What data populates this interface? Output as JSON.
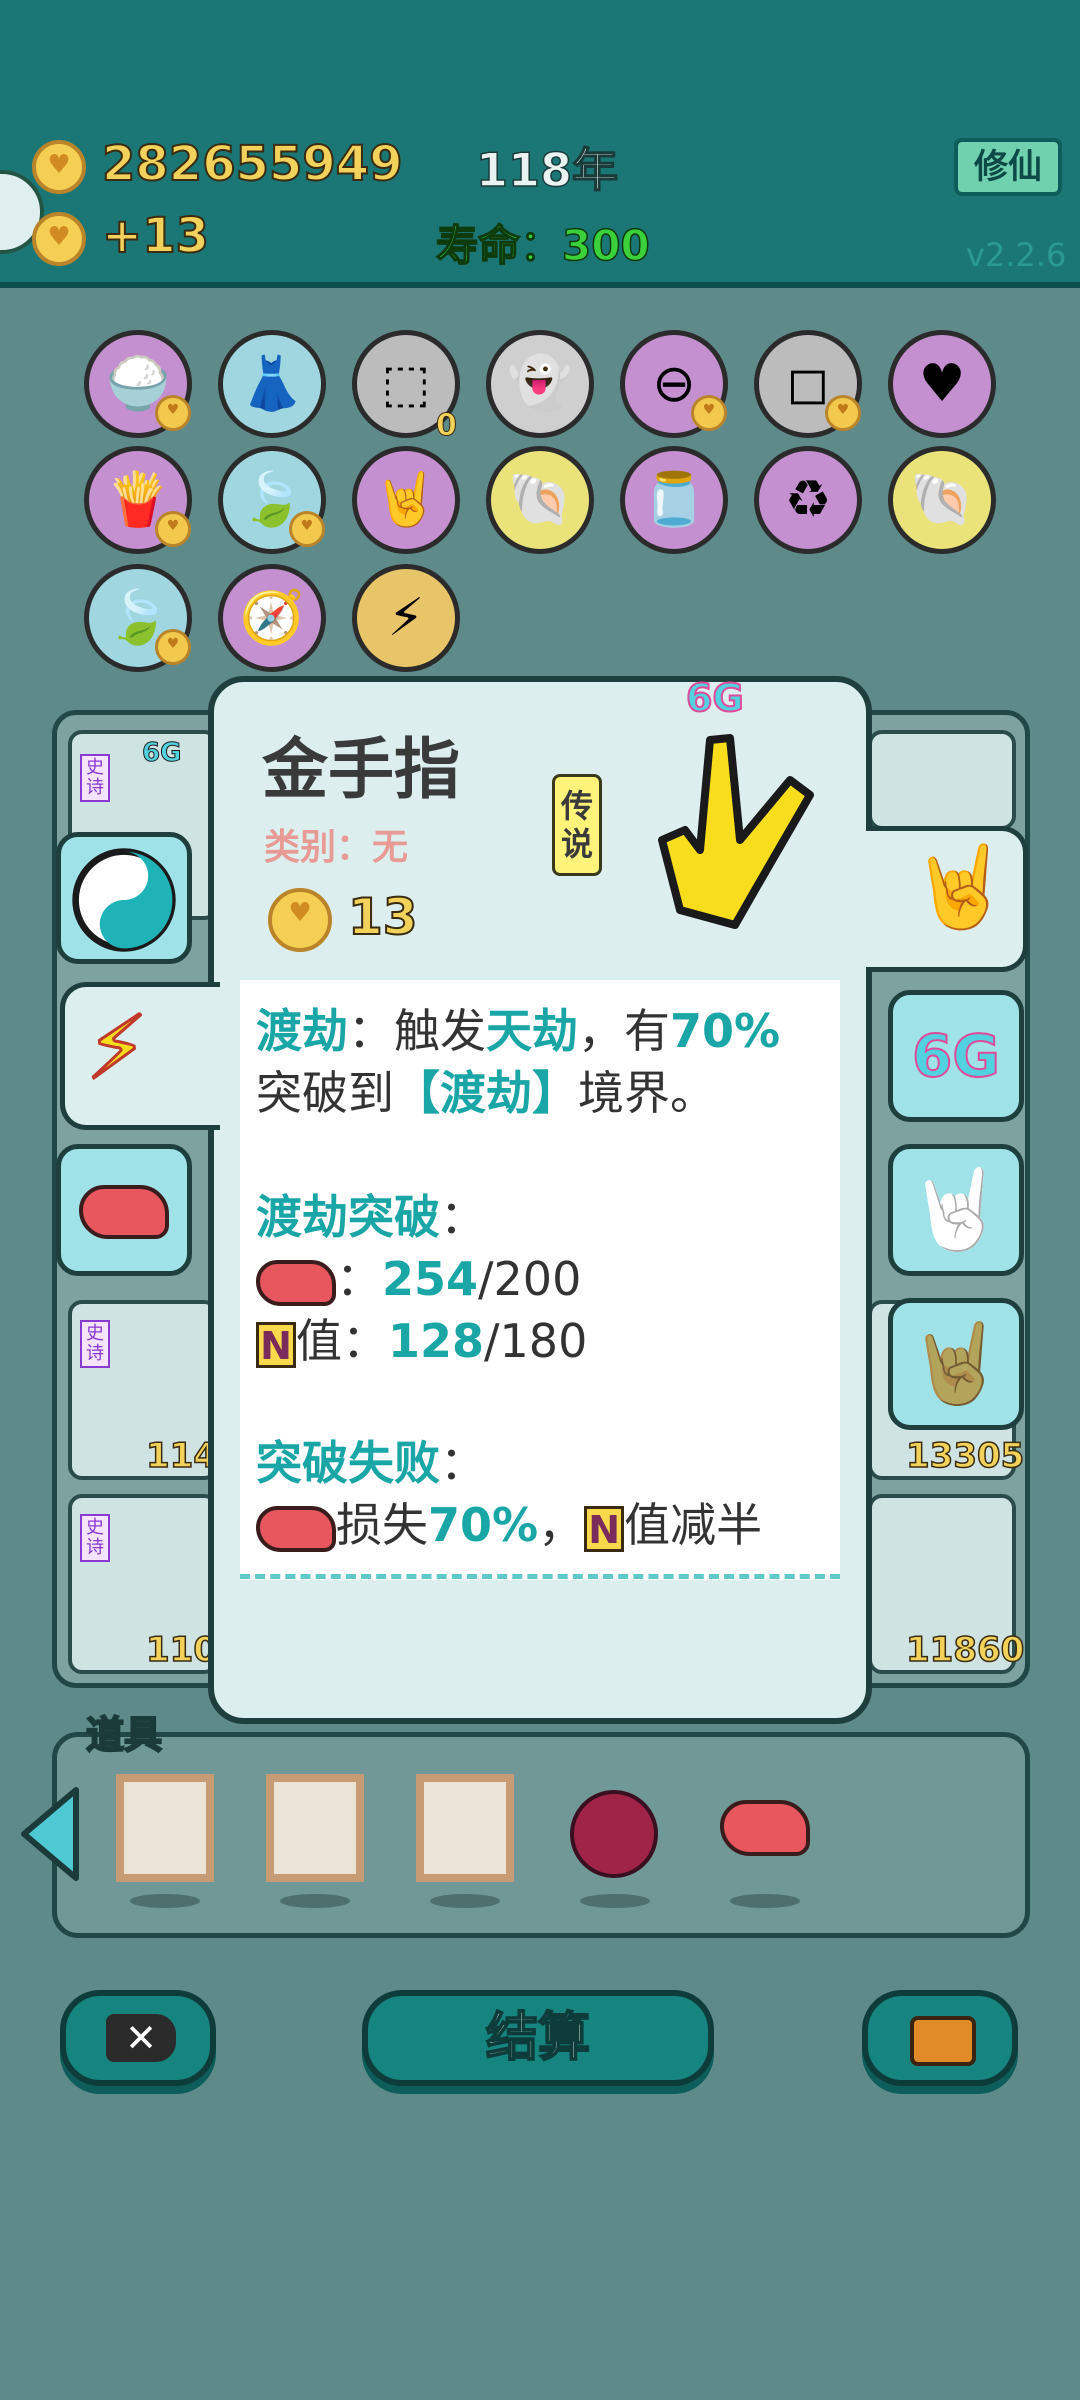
{
  "header": {
    "coins": "282655949",
    "coin_gain": "+13",
    "year": "118年",
    "lifespan_label": "寿命：",
    "lifespan_value": "300",
    "xiuxian_label": "修仙",
    "version": "v2.2.6"
  },
  "icon_grid": {
    "row1": [
      "rice-bowl-icon",
      "skirt-icon",
      "egg-tray-icon",
      "ghost-icon",
      "no-entry-icon",
      "ice-cubes-icon",
      "heart-balloon-icon"
    ],
    "row2": [
      "fries-icon",
      "leaf-icon",
      "rock-hand-icon",
      "shell-icon",
      "jar-icon",
      "recycle-icon",
      "shell-icon"
    ],
    "row3": [
      "leaf-icon",
      "compass-icon",
      "lightning-icon"
    ],
    "egg_count": "0"
  },
  "board_cards": {
    "left_badge": "史诗",
    "left_6g": "6G",
    "left_num1": "114",
    "left_num2": "110",
    "right_num1": "13305",
    "right_num2": "11860"
  },
  "popup": {
    "title": "金手指",
    "category": "类别：无",
    "rarity": "传说",
    "cost": "13",
    "six_g": "6G",
    "p1_a": "渡劫",
    "p1_b": "：触发",
    "p1_c": "天劫",
    "p1_d": "，有",
    "p1_e": "70%",
    "p1_f": "突破到",
    "p1_g": "【渡劫】",
    "p1_h": "境界。",
    "p2_title": "渡劫突破",
    "p2_colon": "：",
    "liver_colon": "：",
    "liver_value": "254",
    "liver_max": "/200",
    "n_letter": "N",
    "n_label": "值：",
    "n_value": "128",
    "n_max": "/180",
    "p3_title": "突破失败",
    "p3_colon": "：",
    "p3_loss": "损失",
    "p3_pct": "70%",
    "p3_sep": "，",
    "p3_n": "N",
    "p3_tail": "值减半"
  },
  "props": {
    "label": "道具"
  },
  "buttons": {
    "settle": "结算"
  }
}
